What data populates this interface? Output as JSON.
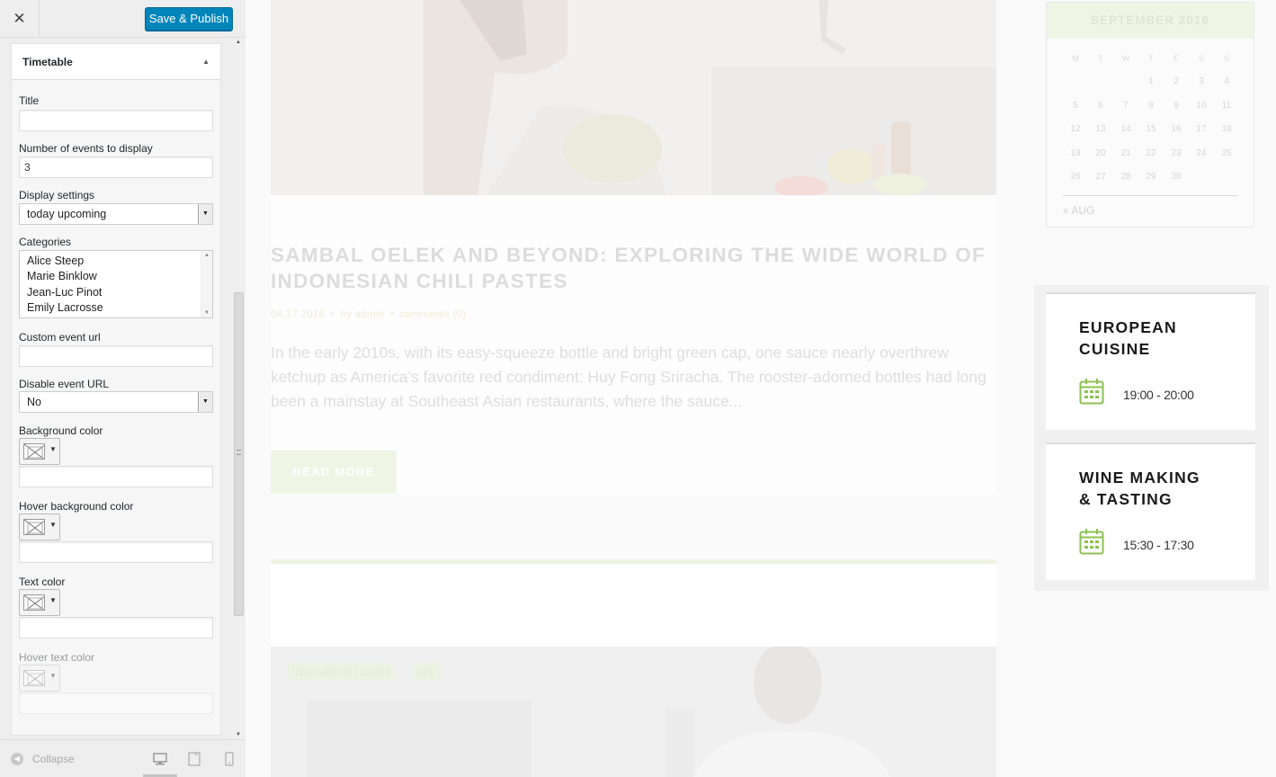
{
  "customizer": {
    "close_label": "✕",
    "save_label": "Save & Publish",
    "section_title": "Timetable",
    "fields": {
      "title_label": "Title",
      "title_value": "",
      "events_label": "Number of events to display",
      "events_value": "3",
      "display_label": "Display settings",
      "display_value": "today upcoming",
      "categories_label": "Categories",
      "categories": [
        "Alice Steep",
        "Marie Binklow",
        "Jean-Luc Pinot",
        "Emily Lacrosse"
      ],
      "custom_url_label": "Custom event url",
      "custom_url_value": "",
      "disable_url_label": "Disable event URL",
      "disable_url_value": "No",
      "bg_color_label": "Background color",
      "hover_bg_color_label": "Hover background color",
      "text_color_label": "Text color",
      "hover_text_color_label": "Hover text color"
    },
    "footer": {
      "collapse_label": "Collapse"
    }
  },
  "preview": {
    "post": {
      "title": "SAMBAL OELEK AND BEYOND: EXPLORING THE WIDE WORLD OF INDONESIAN CHILI PASTES",
      "date": "04.17.2016",
      "author": "by admin",
      "comments": "comments (0)",
      "excerpt": "In the early 2010s, with its easy-squeeze bottle and bright green cap, one sauce nearly overthrew ketchup as America's favorite red condiment: Huy Fong Sriracha. The rooster-adorned bottles had long been a mainstay at Southeast Asian restaurants, where the sauce...",
      "read_more": "READ MORE"
    },
    "second_post_tags": [
      "International Cuisine",
      "tips"
    ],
    "calendar": {
      "month": "SEPTEMBER 2016",
      "weekdays": [
        "M",
        "T",
        "W",
        "T",
        "F",
        "S",
        "S"
      ],
      "weeks": [
        [
          "",
          "",
          "",
          "1",
          "2",
          "3",
          "4"
        ],
        [
          "5",
          "6",
          "7",
          "8",
          "9",
          "10",
          "11"
        ],
        [
          "12",
          "13",
          "14",
          "15",
          "16",
          "17",
          "18"
        ],
        [
          "19",
          "20",
          "21",
          "22",
          "23",
          "24",
          "25"
        ],
        [
          "26",
          "27",
          "28",
          "29",
          "30",
          "",
          ""
        ]
      ],
      "prev_label": "« AUG"
    },
    "events": [
      {
        "title": "EUROPEAN\nCUISINE",
        "time": "19:00 - 20:00"
      },
      {
        "title": "WINE MAKING\n& TASTING",
        "time": "15:30 - 17:30"
      }
    ],
    "colors": {
      "accent_green": "#8cc152",
      "customizer_blue": "#0085ba"
    }
  }
}
